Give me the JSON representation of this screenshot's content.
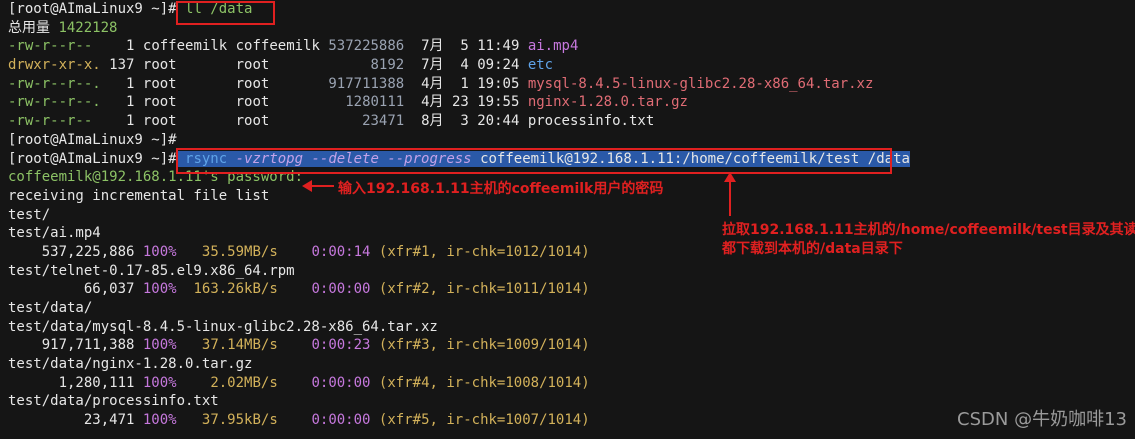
{
  "prompt": "[root@AImaLinux9 ~]#",
  "cmd1": "ll /data",
  "total_label": "总用量",
  "total_value": "1422128",
  "ls_rows": [
    {
      "perm": "-rw-r--r--",
      "links": "1",
      "owner": "coffeemilk",
      "group": "coffeemilk",
      "size": "537225886",
      "month": "7月",
      "day": "5",
      "time": "11:49",
      "name": "ai.mp4",
      "kind": "mp4"
    },
    {
      "perm": "drwxr-xr-x.",
      "links": "137",
      "owner": "root",
      "group": "root",
      "size": "8192",
      "month": "7月",
      "day": "4",
      "time": "09:24",
      "name": "etc",
      "kind": "dir"
    },
    {
      "perm": "-rw-r--r--.",
      "links": "1",
      "owner": "root",
      "group": "root",
      "size": "917711388",
      "month": "4月",
      "day": "1",
      "time": "19:05",
      "name": "mysql-8.4.5-linux-glibc2.28-x86_64.tar.xz",
      "kind": "tar"
    },
    {
      "perm": "-rw-r--r--.",
      "links": "1",
      "owner": "root",
      "group": "root",
      "size": "1280111",
      "month": "4月",
      "day": "23",
      "time": "19:55",
      "name": "nginx-1.28.0.tar.gz",
      "kind": "tar"
    },
    {
      "perm": "-rw-r--r--",
      "links": "1",
      "owner": "root",
      "group": "root",
      "size": "23471",
      "month": "8月",
      "day": "3",
      "time": "20:44",
      "name": "processinfo.txt",
      "kind": "file"
    }
  ],
  "rsync": {
    "cmd": "rsync",
    "opts": "-vzrtopg --delete --progress",
    "src": "coffeemilk@192.168.1.11:/home/coffeemilk/test",
    "dest": "/data"
  },
  "password_prompt": "coffeemilk@192.168.1.11's password:",
  "receiving": "receiving incremental file list",
  "transfer": [
    {
      "path": "test/"
    },
    {
      "path": "test/ai.mp4"
    },
    {
      "bytes": "537,225,886",
      "pct": "100%",
      "rate": "35.59MB/s",
      "elapsed": "0:00:14",
      "xfr": "(xfr#1, ir-chk=1012/1014)"
    },
    {
      "path": "test/telnet-0.17-85.el9.x86_64.rpm"
    },
    {
      "bytes": "66,037",
      "pct": "100%",
      "rate": "163.26kB/s",
      "elapsed": "0:00:00",
      "xfr": "(xfr#2, ir-chk=1011/1014)"
    },
    {
      "path": "test/data/"
    },
    {
      "path": "test/data/mysql-8.4.5-linux-glibc2.28-x86_64.tar.xz"
    },
    {
      "bytes": "917,711,388",
      "pct": "100%",
      "rate": "37.14MB/s",
      "elapsed": "0:00:23",
      "xfr": "(xfr#3, ir-chk=1009/1014)"
    },
    {
      "path": "test/data/nginx-1.28.0.tar.gz"
    },
    {
      "bytes": "1,280,111",
      "pct": "100%",
      "rate": "2.02MB/s",
      "elapsed": "0:00:00",
      "xfr": "(xfr#4, ir-chk=1008/1014)"
    },
    {
      "path": "test/data/processinfo.txt"
    },
    {
      "bytes": "23,471",
      "pct": "100%",
      "rate": "37.95kB/s",
      "elapsed": "0:00:00",
      "xfr": "(xfr#5, ir-chk=1007/1014)"
    }
  ],
  "annotations": {
    "password_note": "输入192.168.1.11主机的coffeemilk用户的密码",
    "pull_note_line1": "拉取192.168.1.11主机的/home/coffeemilk/test目录及其读",
    "pull_note_line2": "都下载到本机的/data目录下"
  },
  "watermark": "CSDN @牛奶咖啡13",
  "colors": {
    "annotation": "#e02020",
    "selection": "#2a59a8",
    "background": "#151515"
  }
}
